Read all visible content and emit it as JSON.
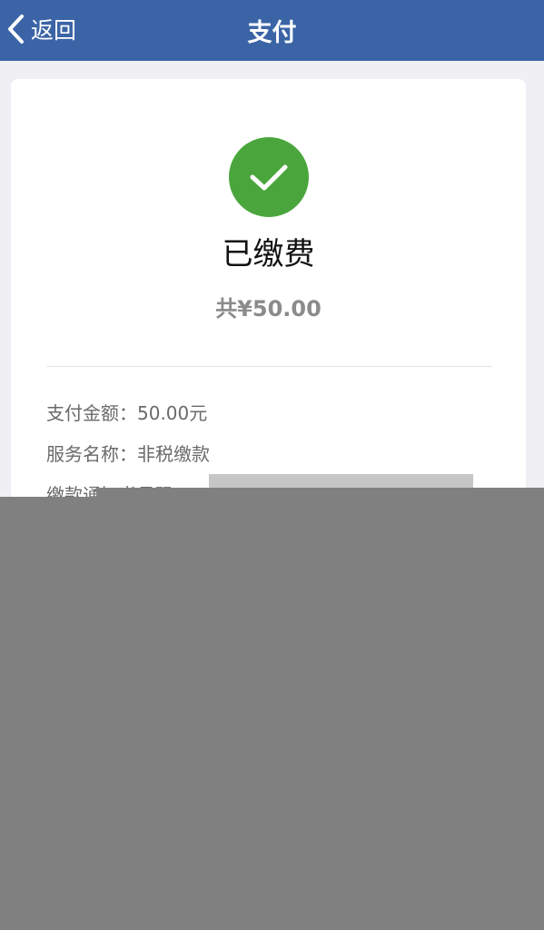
{
  "header": {
    "back_label": "返回",
    "title": "支付",
    "background_color": "#3a64a6"
  },
  "status": {
    "icon": "check-circle-icon",
    "icon_color": "#4aa63c",
    "title": "已缴费",
    "total": "共¥50.00"
  },
  "details": {
    "payment_amount": "支付金额：50.00元",
    "service_name": "服务名称：非税缴款",
    "notice_number": "缴款通知书号码："
  }
}
